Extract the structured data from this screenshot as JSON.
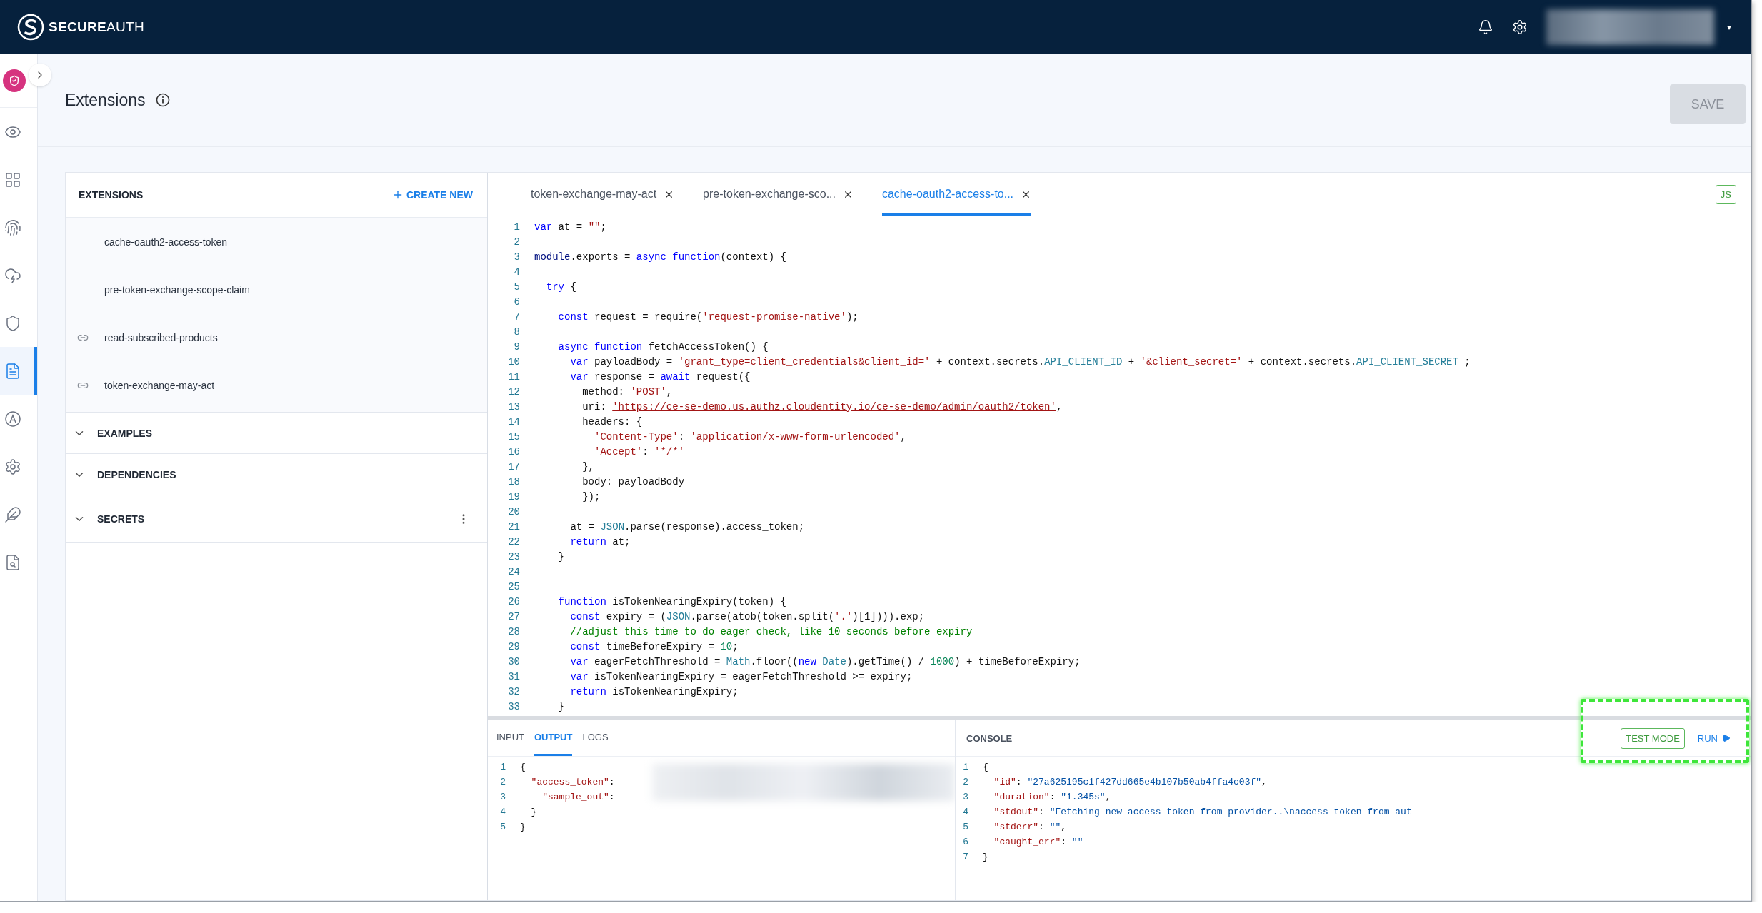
{
  "topbar": {
    "brand_strong": "SECURE",
    "brand_light": "AUTH",
    "user_caret": "▾"
  },
  "rail": [
    {
      "kind": "eye",
      "selected": false
    },
    {
      "kind": "grid",
      "selected": false
    },
    {
      "kind": "fingerprint",
      "selected": false
    },
    {
      "kind": "cloud",
      "selected": false
    },
    {
      "kind": "shield",
      "selected": false
    },
    {
      "kind": "file",
      "selected": true
    },
    {
      "kind": "badge",
      "selected": false
    },
    {
      "kind": "gear",
      "selected": false
    },
    {
      "kind": "feather",
      "selected": false
    },
    {
      "kind": "search-file",
      "selected": false
    }
  ],
  "header": {
    "title": "Extensions",
    "save": "SAVE",
    "save_disabled": true
  },
  "extensions": {
    "title": "EXTENSIONS",
    "create": "CREATE NEW",
    "items": [
      {
        "name": "cache-oauth2-access-token",
        "linked": false,
        "selected": false
      },
      {
        "name": "pre-token-exchange-scope-claim",
        "linked": false,
        "selected": false
      },
      {
        "name": "read-subscribed-products",
        "linked": true,
        "selected": false
      },
      {
        "name": "token-exchange-may-act",
        "linked": true,
        "selected": false
      }
    ],
    "sections": [
      {
        "label": "EXAMPLES",
        "menu": false
      },
      {
        "label": "DEPENDENCIES",
        "menu": false
      },
      {
        "label": "SECRETS",
        "menu": true
      }
    ]
  },
  "editor_tabs": [
    {
      "label": "token-exchange-may-act",
      "selected": false
    },
    {
      "label": "pre-token-exchange-sco...",
      "selected": false
    },
    {
      "label": "cache-oauth2-access-to...",
      "selected": true
    }
  ],
  "language_badge": "JS",
  "code": [
    {
      "n": "1",
      "t": [
        {
          "kind": "k",
          "text": "var "
        },
        {
          "kind": "p",
          "text": "at = "
        },
        {
          "kind": "s",
          "text": "\"\""
        },
        {
          "kind": "p",
          "text": ";"
        }
      ]
    },
    {
      "n": "2"
    },
    {
      "n": "3",
      "t": [
        {
          "kind": "m",
          "text": "module"
        },
        {
          "kind": "p",
          "text": ".exports = "
        },
        {
          "kind": "k",
          "text": "async function"
        },
        {
          "kind": "p",
          "text": "(context) {"
        }
      ]
    },
    {
      "n": "4"
    },
    {
      "n": "5",
      "t": [
        {
          "kind": "k",
          "text": "  try"
        },
        {
          "kind": "p",
          "text": " {"
        }
      ]
    },
    {
      "n": "6"
    },
    {
      "n": "7",
      "t": [
        {
          "kind": "k",
          "text": "    const"
        },
        {
          "kind": "p",
          "text": " request = require("
        },
        {
          "kind": "s",
          "text": "'request-promise-native'"
        },
        {
          "kind": "p",
          "text": ");"
        }
      ]
    },
    {
      "n": "8"
    },
    {
      "n": "9",
      "t": [
        {
          "kind": "k",
          "text": "    async function"
        },
        {
          "kind": "p",
          "text": " fetchAccessToken() {"
        }
      ]
    },
    {
      "n": "10",
      "t": [
        {
          "kind": "k",
          "text": "      var"
        },
        {
          "kind": "p",
          "text": " payloadBody = "
        },
        {
          "kind": "s",
          "text": "'grant_type=client_credentials&client_id='"
        },
        {
          "kind": "p",
          "text": " + context.secrets."
        },
        {
          "kind": "b",
          "text": "API_CLIENT_ID"
        },
        {
          "kind": "p",
          "text": " + "
        },
        {
          "kind": "s",
          "text": "'&client_secret='"
        },
        {
          "kind": "p",
          "text": " + context.secrets."
        },
        {
          "kind": "b",
          "text": "API_CLIENT_SECRET"
        },
        {
          "kind": "p",
          "text": " ;"
        }
      ]
    },
    {
      "n": "11",
      "t": [
        {
          "kind": "k",
          "text": "      var"
        },
        {
          "kind": "p",
          "text": " response = "
        },
        {
          "kind": "k",
          "text": "await"
        },
        {
          "kind": "p",
          "text": " request({"
        }
      ]
    },
    {
      "n": "12",
      "t": [
        {
          "kind": "p",
          "text": "        method: "
        },
        {
          "kind": "s",
          "text": "'POST'"
        },
        {
          "kind": "p",
          "text": ","
        }
      ]
    },
    {
      "n": "13",
      "t": [
        {
          "kind": "p",
          "text": "        uri: "
        },
        {
          "kind": "u",
          "text": "'https://ce-se-demo.us.authz.cloudentity.io/ce-se-demo/admin/oauth2/token'"
        },
        {
          "kind": "p",
          "text": ","
        }
      ]
    },
    {
      "n": "14",
      "t": [
        {
          "kind": "p",
          "text": "        headers: {"
        }
      ]
    },
    {
      "n": "15",
      "t": [
        {
          "kind": "s",
          "text": "          'Content-Type'"
        },
        {
          "kind": "p",
          "text": ": "
        },
        {
          "kind": "s",
          "text": "'application/x-www-form-urlencoded'"
        },
        {
          "kind": "p",
          "text": ","
        }
      ]
    },
    {
      "n": "16",
      "t": [
        {
          "kind": "s",
          "text": "          'Accept'"
        },
        {
          "kind": "p",
          "text": ": "
        },
        {
          "kind": "s",
          "text": "'*/*'"
        }
      ]
    },
    {
      "n": "17",
      "t": [
        {
          "kind": "p",
          "text": "        },"
        }
      ]
    },
    {
      "n": "18",
      "t": [
        {
          "kind": "p",
          "text": "        body: payloadBody"
        }
      ]
    },
    {
      "n": "19",
      "t": [
        {
          "kind": "p",
          "text": "        });"
        }
      ]
    },
    {
      "n": "20"
    },
    {
      "n": "21",
      "t": [
        {
          "kind": "p",
          "text": "      at = "
        },
        {
          "kind": "b",
          "text": "JSON"
        },
        {
          "kind": "p",
          "text": ".parse(response).access_token;"
        }
      ]
    },
    {
      "n": "22",
      "t": [
        {
          "kind": "k",
          "text": "      return"
        },
        {
          "kind": "p",
          "text": " at;"
        }
      ]
    },
    {
      "n": "23",
      "t": [
        {
          "kind": "p",
          "text": "    }"
        }
      ]
    },
    {
      "n": "24"
    },
    {
      "n": "25"
    },
    {
      "n": "26",
      "t": [
        {
          "kind": "k",
          "text": "    function"
        },
        {
          "kind": "p",
          "text": " isTokenNearingExpiry(token) {"
        }
      ]
    },
    {
      "n": "27",
      "t": [
        {
          "kind": "k",
          "text": "      const"
        },
        {
          "kind": "p",
          "text": " expiry = ("
        },
        {
          "kind": "b",
          "text": "JSON"
        },
        {
          "kind": "p",
          "text": ".parse(atob(token.split("
        },
        {
          "kind": "s",
          "text": "'.'"
        },
        {
          "kind": "p",
          "text": ")[1]))).exp;"
        }
      ]
    },
    {
      "n": "28",
      "t": [
        {
          "kind": "c",
          "text": "      //adjust this time to do eager check, like 10 seconds before expiry"
        }
      ]
    },
    {
      "n": "29",
      "t": [
        {
          "kind": "k",
          "text": "      const"
        },
        {
          "kind": "p",
          "text": " timeBeforeExpiry = "
        },
        {
          "kind": "n",
          "text": "10"
        },
        {
          "kind": "p",
          "text": ";"
        }
      ]
    },
    {
      "n": "30",
      "t": [
        {
          "kind": "k",
          "text": "      var"
        },
        {
          "kind": "p",
          "text": " eagerFetchThreshold = "
        },
        {
          "kind": "b",
          "text": "Math"
        },
        {
          "kind": "p",
          "text": ".floor(("
        },
        {
          "kind": "k",
          "text": "new "
        },
        {
          "kind": "b",
          "text": "Date"
        },
        {
          "kind": "p",
          "text": ").getTime() / "
        },
        {
          "kind": "n",
          "text": "1000"
        },
        {
          "kind": "p",
          "text": ") + timeBeforeExpiry;"
        }
      ]
    },
    {
      "n": "31",
      "t": [
        {
          "kind": "k",
          "text": "      var"
        },
        {
          "kind": "p",
          "text": " isTokenNearingExpiry = eagerFetchThreshold >= expiry;"
        }
      ]
    },
    {
      "n": "32",
      "t": [
        {
          "kind": "k",
          "text": "      return"
        },
        {
          "kind": "p",
          "text": " isTokenNearingExpiry;"
        }
      ]
    },
    {
      "n": "33",
      "t": [
        {
          "kind": "p",
          "text": "    }"
        }
      ]
    }
  ],
  "io_tabs": [
    {
      "label": "INPUT",
      "selected": false
    },
    {
      "label": "OUTPUT",
      "selected": true
    },
    {
      "label": "LOGS",
      "selected": false
    }
  ],
  "output": [
    {
      "n": "1",
      "t": [
        {
          "kind": "p",
          "text": "{"
        }
      ]
    },
    {
      "n": "2",
      "t": [
        {
          "kind": "key",
          "text": "  \"access_token\""
        },
        {
          "kind": "p",
          "text": ":"
        }
      ]
    },
    {
      "n": "3",
      "t": [
        {
          "kind": "key",
          "text": "    \"sample_out\""
        },
        {
          "kind": "p",
          "text": ":"
        }
      ]
    },
    {
      "n": "4",
      "t": [
        {
          "kind": "p",
          "text": "  }"
        }
      ]
    },
    {
      "n": "5",
      "t": [
        {
          "kind": "p",
          "text": "}"
        }
      ]
    }
  ],
  "console": {
    "title": "CONSOLE",
    "test_mode": "TEST MODE",
    "run": "RUN",
    "lines": [
      {
        "n": "1",
        "t": [
          {
            "kind": "p",
            "text": "{"
          }
        ]
      },
      {
        "n": "2",
        "t": [
          {
            "kind": "key",
            "text": "  \"id\""
          },
          {
            "kind": "p",
            "text": ": "
          },
          {
            "kind": "val",
            "text": "\"27a625195c1f427dd665e4b107b50ab4ffa4c03f\""
          },
          {
            "kind": "p",
            "text": ","
          }
        ]
      },
      {
        "n": "3",
        "t": [
          {
            "kind": "key",
            "text": "  \"duration\""
          },
          {
            "kind": "p",
            "text": ": "
          },
          {
            "kind": "val",
            "text": "\"1.345s\""
          },
          {
            "kind": "p",
            "text": ","
          }
        ]
      },
      {
        "n": "4",
        "t": [
          {
            "kind": "key",
            "text": "  \"stdout\""
          },
          {
            "kind": "p",
            "text": ": "
          },
          {
            "kind": "val",
            "text": "\"Fetching new access token from provider..\\naccess token from aut"
          }
        ]
      },
      {
        "n": "5",
        "t": [
          {
            "kind": "key",
            "text": "  \"stderr\""
          },
          {
            "kind": "p",
            "text": ": "
          },
          {
            "kind": "val",
            "text": "\"\""
          },
          {
            "kind": "p",
            "text": ","
          }
        ]
      },
      {
        "n": "6",
        "t": [
          {
            "kind": "key",
            "text": "  \"caught_err\""
          },
          {
            "kind": "p",
            "text": ": "
          },
          {
            "kind": "val",
            "text": "\"\""
          }
        ]
      },
      {
        "n": "7",
        "t": [
          {
            "kind": "p",
            "text": "}"
          }
        ]
      }
    ]
  }
}
